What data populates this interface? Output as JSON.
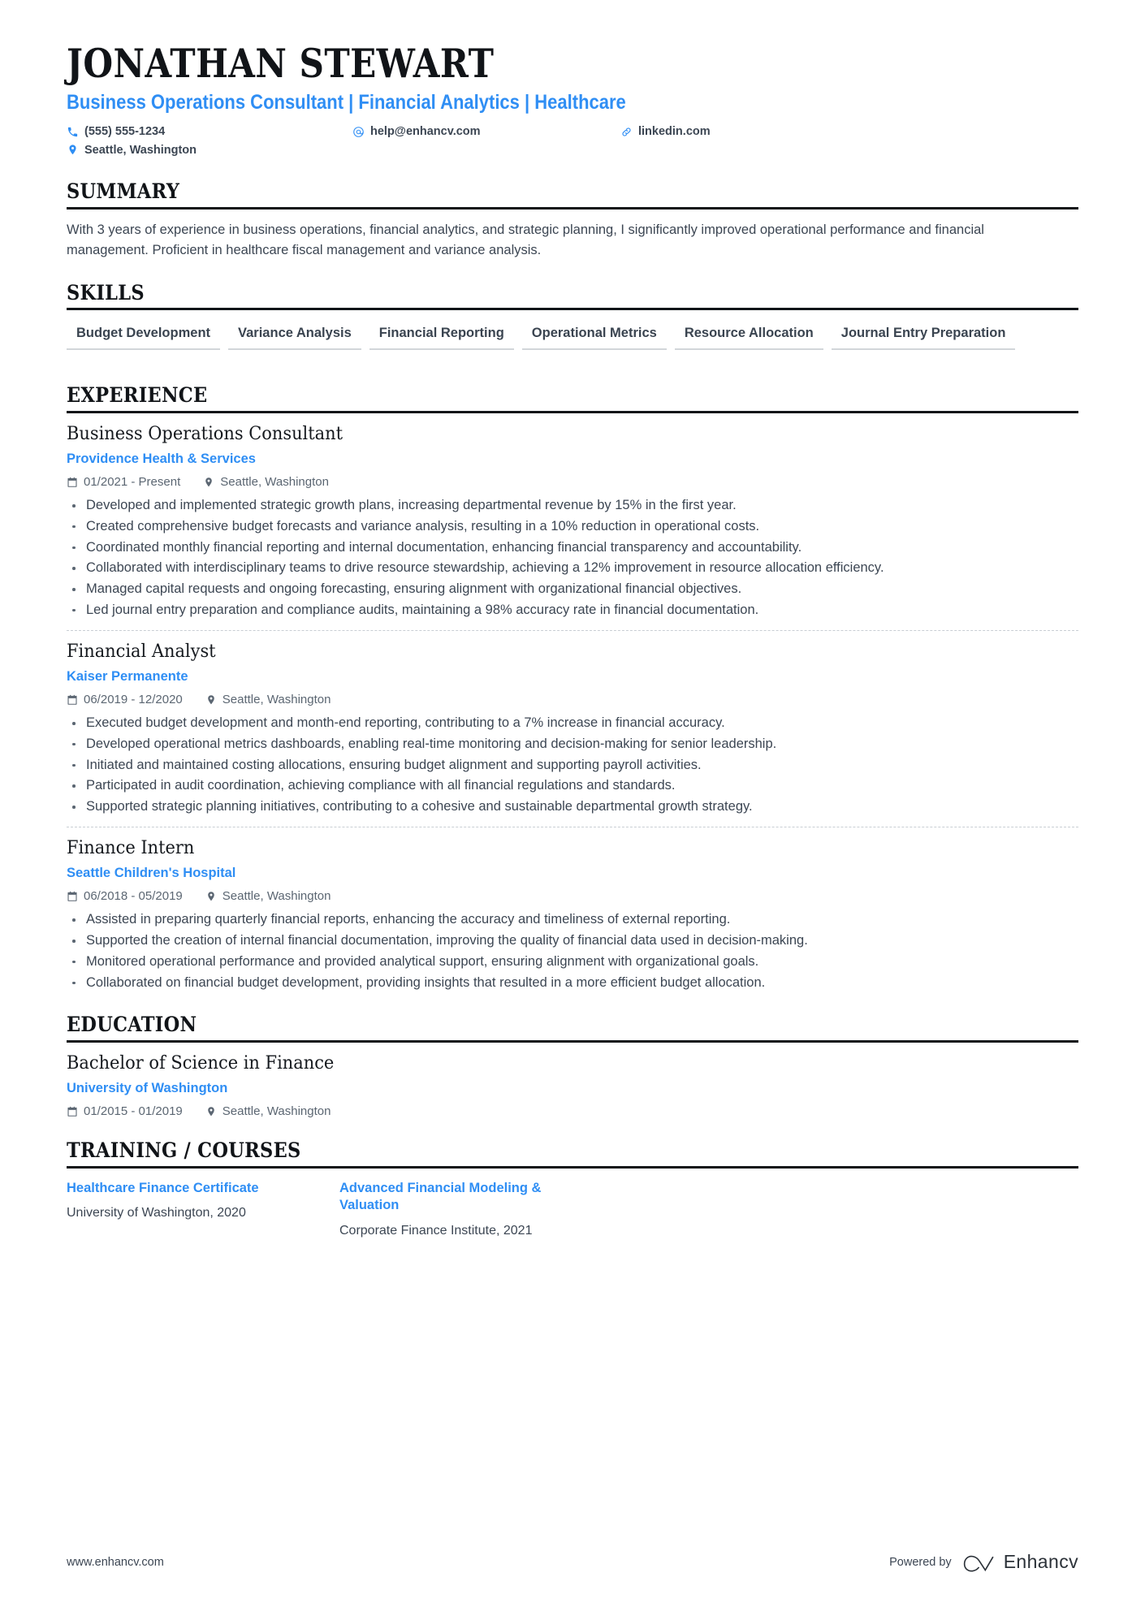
{
  "accent_color": "#2f8ef4",
  "text_color": "#3c4653",
  "header": {
    "name": "JONATHAN STEWART",
    "subtitle": "Business Operations Consultant | Financial Analytics | Healthcare",
    "contacts": {
      "phone": "(555) 555-1234",
      "email": "help@enhancv.com",
      "link": "linkedin.com",
      "location": "Seattle, Washington"
    }
  },
  "sections": {
    "summary": {
      "title": "SUMMARY",
      "text": "With 3 years of experience in business operations, financial analytics, and strategic planning, I significantly improved operational performance and financial management. Proficient in healthcare fiscal management and variance analysis."
    },
    "skills": {
      "title": "SKILLS",
      "items": [
        "Budget Development",
        "Variance Analysis",
        "Financial Reporting",
        "Operational Metrics",
        "Resource Allocation",
        "Journal Entry Preparation"
      ]
    },
    "experience": {
      "title": "EXPERIENCE",
      "entries": [
        {
          "title": "Business Operations Consultant",
          "org": "Providence Health & Services",
          "dates": "01/2021 - Present",
          "location": "Seattle, Washington",
          "bullets": [
            "Developed and implemented strategic growth plans, increasing departmental revenue by 15% in the first year.",
            "Created comprehensive budget forecasts and variance analysis, resulting in a 10% reduction in operational costs.",
            "Coordinated monthly financial reporting and internal documentation, enhancing financial transparency and accountability.",
            "Collaborated with interdisciplinary teams to drive resource stewardship, achieving a 12% improvement in resource allocation efficiency.",
            "Managed capital requests and ongoing forecasting, ensuring alignment with organizational financial objectives.",
            "Led journal entry preparation and compliance audits, maintaining a 98% accuracy rate in financial documentation."
          ]
        },
        {
          "title": "Financial Analyst",
          "org": "Kaiser Permanente",
          "dates": "06/2019 - 12/2020",
          "location": "Seattle, Washington",
          "bullets": [
            "Executed budget development and month-end reporting, contributing to a 7% increase in financial accuracy.",
            "Developed operational metrics dashboards, enabling real-time monitoring and decision-making for senior leadership.",
            "Initiated and maintained costing allocations, ensuring budget alignment and supporting payroll activities.",
            "Participated in audit coordination, achieving compliance with all financial regulations and standards.",
            "Supported strategic planning initiatives, contributing to a cohesive and sustainable departmental growth strategy."
          ]
        },
        {
          "title": "Finance Intern",
          "org": "Seattle Children's Hospital",
          "dates": "06/2018 - 05/2019",
          "location": "Seattle, Washington",
          "bullets": [
            "Assisted in preparing quarterly financial reports, enhancing the accuracy and timeliness of external reporting.",
            "Supported the creation of internal financial documentation, improving the quality of financial data used in decision-making.",
            "Monitored operational performance and provided analytical support, ensuring alignment with organizational goals.",
            "Collaborated on financial budget development, providing insights that resulted in a more efficient budget allocation."
          ]
        }
      ]
    },
    "education": {
      "title": "EDUCATION",
      "entries": [
        {
          "title": "Bachelor of Science in Finance",
          "org": "University of Washington",
          "dates": "01/2015 - 01/2019",
          "location": "Seattle, Washington"
        }
      ]
    },
    "training": {
      "title": "TRAINING / COURSES",
      "courses": [
        {
          "title": "Healthcare Finance Certificate",
          "subtitle": "University of Washington, 2020"
        },
        {
          "title": "Advanced Financial Modeling & Valuation",
          "subtitle": "Corporate Finance Institute, 2021"
        }
      ]
    }
  },
  "footer": {
    "url": "www.enhancv.com",
    "powered_by": "Powered by",
    "brand": "Enhancv"
  }
}
